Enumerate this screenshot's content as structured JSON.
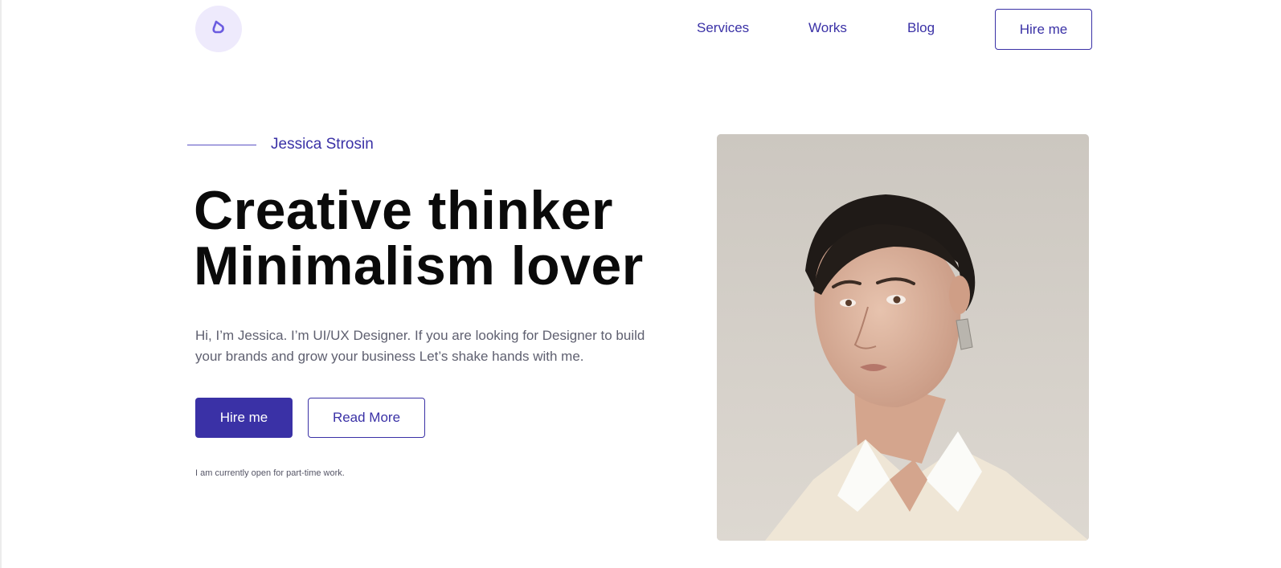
{
  "header": {
    "logo_icon": "drop-logo-icon",
    "nav": [
      {
        "label": "Services"
      },
      {
        "label": "Works"
      },
      {
        "label": "Blog"
      }
    ],
    "hire_label": "Hire me"
  },
  "hero": {
    "name": "Jessica Strosin",
    "headline_line1": "Creative thinker",
    "headline_line2": "Minimalism lover",
    "intro": "Hi, I’m Jessica. I’m UI/UX Designer. If you are looking for Designer to build your brands and grow your business Let’s shake hands with me.",
    "primary_button": "Hire me",
    "secondary_button": "Read More",
    "status_note": "I am currently open for part-time work."
  },
  "portrait": {
    "subject": "woman-portrait"
  },
  "colors": {
    "accent": "#3a31a6",
    "accent_light": "#eeeafc",
    "heading": "#0a0a0a",
    "body_text": "#5f6070"
  }
}
